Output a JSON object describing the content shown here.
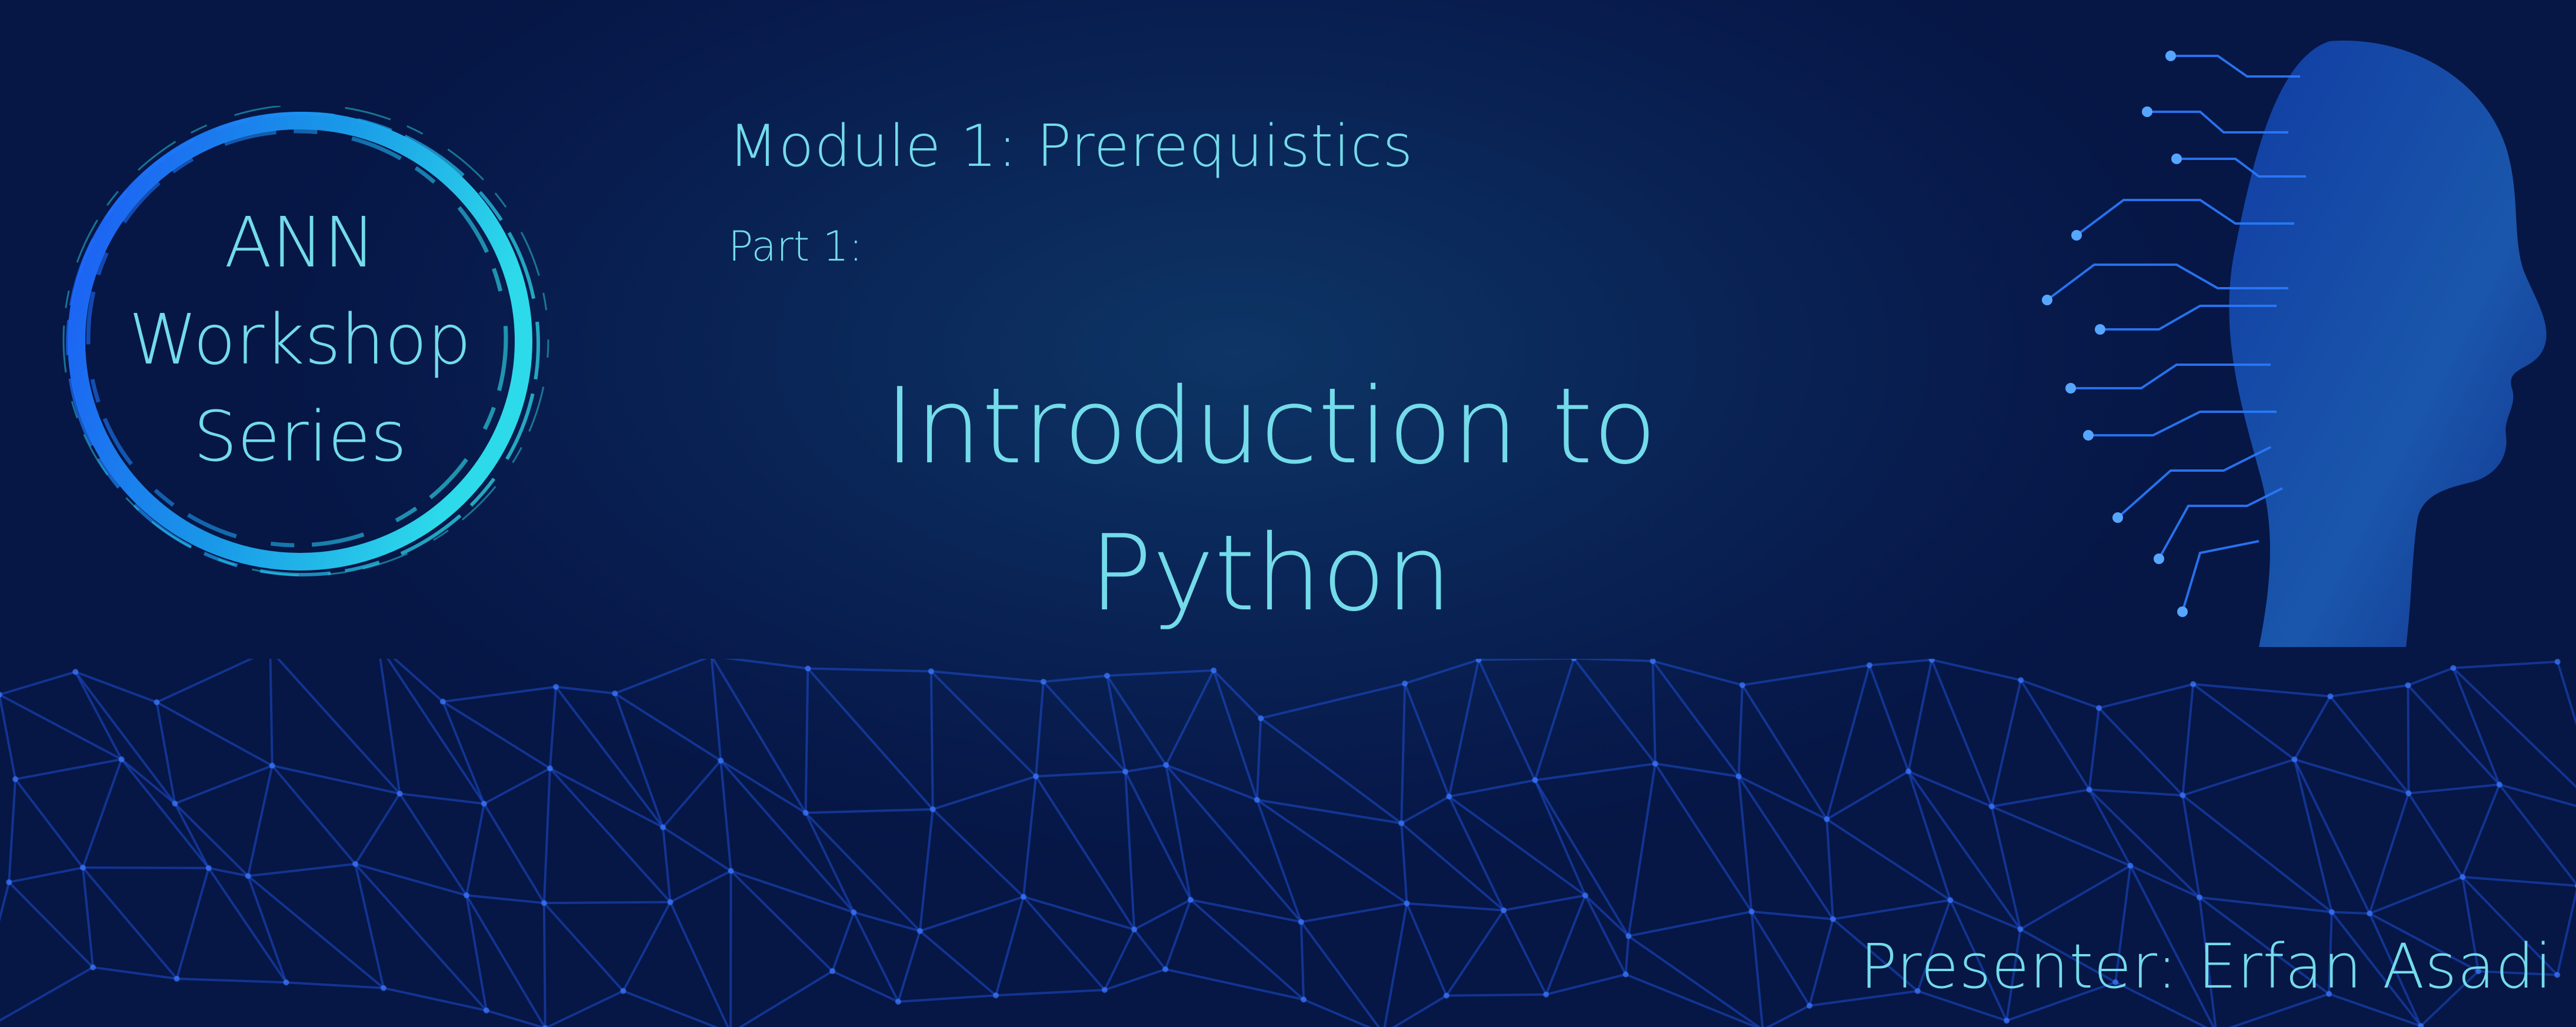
{
  "badge": {
    "line1": "ANN",
    "line2": "Workshop",
    "line3": "Series"
  },
  "module_title": "Module 1: Prerequistics",
  "part_label": "Part 1:",
  "main_title": {
    "line1": "Introduction to",
    "line2": "Python"
  },
  "presenter": "Presenter: Erfan Asadi",
  "colors": {
    "background": "#0a2557",
    "text": "#73dbe9",
    "ring_start": "#1e5cff",
    "ring_end": "#2fe4f2",
    "network": "#1d4fd0"
  },
  "icons": {
    "badge": "brush-circle-icon",
    "head": "circuit-head-icon",
    "mesh": "polygon-network-pattern"
  }
}
